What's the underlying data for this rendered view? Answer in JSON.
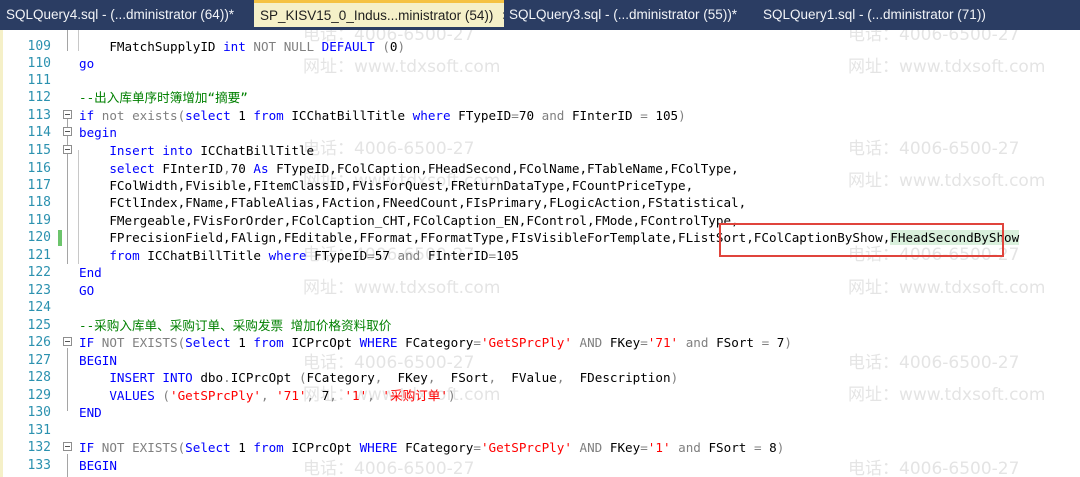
{
  "tabs": [
    {
      "label": "SQLQuery4.sql - (...dministrator (64))*",
      "active": false
    },
    {
      "label": "SP_KISV15_0_Indus...ministrator (54))",
      "active": true,
      "close": "✕"
    },
    {
      "label": "SQLQuery3.sql - (...dministrator (55))*",
      "active": false
    },
    {
      "label": "SQLQuery1.sql - (...dministrator (71))",
      "active": false
    }
  ],
  "watermarks": {
    "phone": "电话：4006-6500-27",
    "web": "网址：www.tdxsoft.com"
  },
  "colors": {
    "tabbar": "#2b3d63",
    "active_tab": "#f5f0c8",
    "keyword": "#0000ff",
    "comment": "#008000",
    "string": "#ff0000",
    "line_number": "#2b91af",
    "highlight_box": "#e0443c"
  },
  "code": {
    "l109": "109",
    "l110": "110",
    "l111": "111",
    "l112": "112",
    "l113": "113",
    "l114": "114",
    "l115": "115",
    "l116": "116",
    "l117": "117",
    "l118": "118",
    "l119": "119",
    "l120": "120",
    "l121": "121",
    "l122": "122",
    "l123": "123",
    "l124": "124",
    "l125": "125",
    "l126": "126",
    "l127": "127",
    "l128": "128",
    "l129": "129",
    "l130": "130",
    "l131": "131",
    "l132": "132",
    "l133": "133",
    "t109a": "    FMatchSupplyID ",
    "t109b": "int",
    "t109c": " NOT NULL",
    "t109d": " DEFAULT ",
    "t109e": "(",
    "t109f": "0",
    "t109g": ")",
    "t110": "go",
    "t112": "--出入库单序时簿增加“摘要”",
    "t113a": "if",
    "t113b": " not exists",
    "t113c": "(",
    "t113d": "select",
    "t113e": " 1 ",
    "t113f": "from",
    "t113g": " ICChatBillTitle ",
    "t113h": "where",
    "t113i": " FTypeID",
    "t113j": "=",
    "t113k": "70 ",
    "t113l": "and",
    "t113m": " FInterID ",
    "t113n": "=",
    "t113o": " 105",
    "t113p": ")",
    "t114": "begin",
    "t115a": "    Insert",
    "t115b": " into",
    "t115c": " ICChatBillTitle",
    "t116a": "    select",
    "t116b": " FInterID",
    "t116c": ",",
    "t116d": "70 ",
    "t116e": "As",
    "t116f": " FTypeID",
    "t116g": ",FColCaption,FHeadSecond,FColName,FTableName,FColType,",
    "t117": "    FColWidth,FVisible,FItemClassID,FVisForQuest,FReturnDataType,FCountPriceType,",
    "t118": "    FCtlIndex,FName,FTableAlias,FAction,FNeedCount,FIsPrimary,FLogicAction,FStatistical,",
    "t119": "    FMergeable,FVisForOrder,FColCaption_CHT,FColCaption_EN,FControl,FMode,FControlType,",
    "t120a": "    FPrecisionField,FAlign,FEditable,FFormat,FFormatType,FIsVisibleForTemplate,FListSort,FColCaptionByShow,",
    "t120b": "FHeadSecondByShow",
    "t121a": "    from",
    "t121b": " ICChatBillTitle ",
    "t121c": "where",
    "t121d": " FTypeID",
    "t121e": "=",
    "t121f": "57 ",
    "t121g": "and",
    "t121h": " FInterID",
    "t121i": "=",
    "t121j": "105",
    "t122": "End",
    "t123": "GO",
    "t125": "--采购入库单、采购订单、采购发票 增加价格资料取价",
    "t126a": "IF",
    "t126b": " NOT EXISTS",
    "t126c": "(",
    "t126d": "Select",
    "t126e": " 1 ",
    "t126f": "from",
    "t126g": " ICPrcOpt ",
    "t126h": "WHERE",
    "t126i": " FCategory",
    "t126j": "=",
    "t126k": "'GetSPrcPly'",
    "t126l": " AND",
    "t126m": " FKey",
    "t126n": "=",
    "t126o": "'71'",
    "t126p": " and",
    "t126q": " FSort ",
    "t126r": "=",
    "t126s": " 7",
    "t126t": ")",
    "t127": "BEGIN",
    "t128a": "    INSERT",
    "t128b": " INTO",
    "t128c": " dbo",
    "t128d": ".",
    "t128e": "ICPrcOpt ",
    "t128f": "(",
    "t128g": "FCategory",
    "t128h": ",",
    "t128i": "  FKey",
    "t128j": ",",
    "t128k": "  FSort",
    "t128l": ",",
    "t128m": "  FValue",
    "t128n": ",",
    "t128o": "  FDescription",
    "t128p": ")",
    "t129a": "    VALUES ",
    "t129b": "(",
    "t129c": "'GetSPrcPly'",
    "t129d": ",",
    "t129e": " '71'",
    "t129f": ",",
    "t129g": " 7",
    "t129h": ",",
    "t129i": " '1'",
    "t129j": ",",
    "t129k": " '采购订单'",
    "t129l": ")",
    "t130": "END",
    "t132a": "IF",
    "t132b": " NOT EXISTS",
    "t132c": "(",
    "t132d": "Select",
    "t132e": " 1 ",
    "t132f": "from",
    "t132g": " ICPrcOpt ",
    "t132h": "WHERE",
    "t132i": " FCategory",
    "t132j": "=",
    "t132k": "'GetSPrcPly'",
    "t132l": " AND",
    "t132m": " FKey",
    "t132n": "=",
    "t132o": "'1'",
    "t132p": " and",
    "t132q": " FSort ",
    "t132r": "=",
    "t132s": " 8",
    "t132t": ")",
    "t133": "BEGIN"
  }
}
